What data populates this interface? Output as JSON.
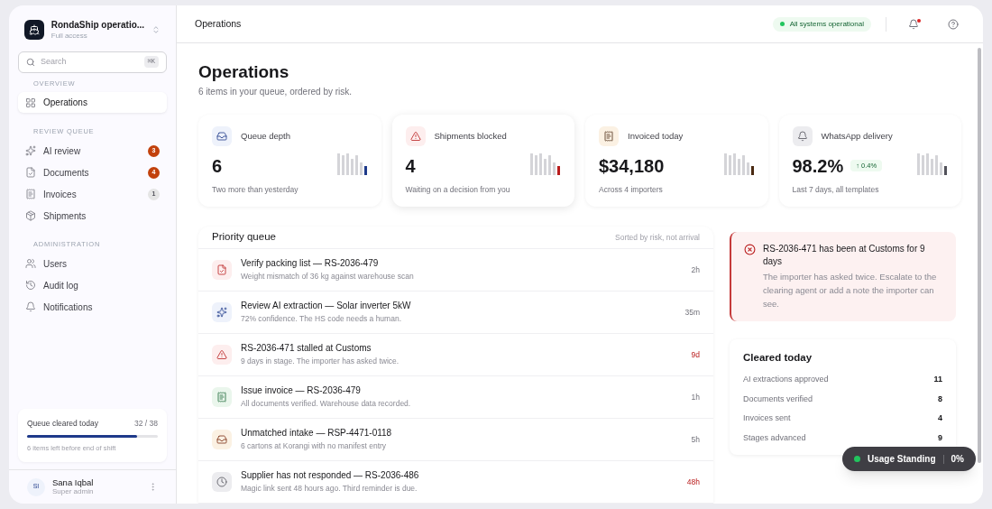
{
  "workspace": {
    "name": "RondaShip operatio...",
    "subtitle": "Full access"
  },
  "search": {
    "placeholder": "Search",
    "shortcut": "⌘K"
  },
  "sidebar": {
    "sections": [
      {
        "title": "OVERVIEW",
        "items": [
          {
            "label": "Operations",
            "kind": "grid",
            "selected": true
          }
        ]
      },
      {
        "title": "REVIEW QUEUE",
        "items": [
          {
            "label": "AI review",
            "kind": "sparkle",
            "selected": false,
            "badge": "3",
            "color": "#c2410c"
          },
          {
            "label": "Documents",
            "kind": "document",
            "selected": false,
            "badge": "4",
            "color": "#c2410c"
          },
          {
            "label": "Invoices",
            "kind": "invoice",
            "selected": false,
            "badge": "1",
            "color": "#e5e5e5"
          },
          {
            "label": "Shipments",
            "kind": "box",
            "selected": false
          }
        ]
      },
      {
        "title": "ADMINISTRATION",
        "items": [
          {
            "label": "Users",
            "kind": "users",
            "selected": false
          },
          {
            "label": "Audit log",
            "kind": "history",
            "selected": false
          },
          {
            "label": "Notifications",
            "kind": "bell",
            "selected": false
          }
        ]
      }
    ]
  },
  "progress": {
    "title": "Queue cleared today",
    "count": "32 / 38",
    "level": 0.84,
    "note": "6 items left before end of shift"
  },
  "user": {
    "initials": "SI",
    "name": "Sana Iqbal",
    "role": "Super admin"
  },
  "topbar": {
    "title": "Operations",
    "status": "All systems operational"
  },
  "page": {
    "title": "Operations",
    "subtitle": "6 items in your queue, ordered by risk."
  },
  "stats": [
    {
      "kind": "inbox",
      "label": "Queue depth",
      "value": "6",
      "note": "Two more than yesterday",
      "color": "#1e3a8a"
    },
    {
      "kind": "warning",
      "label": "Shipments blocked",
      "value": "4",
      "note": "Waiting on a decision from you",
      "color": "#b91c1c"
    },
    {
      "kind": "invoice",
      "label": "Invoiced today",
      "value": "$34,180",
      "note": "Across 4 importers",
      "color": "#4a2a12"
    },
    {
      "kind": "bell",
      "label": "WhatsApp delivery",
      "value": "98.2%",
      "delta": "↑ 0.4%",
      "note": "Last 7 days, all templates",
      "color": "#52525b"
    }
  ],
  "queue": {
    "title": "Priority queue",
    "hint": "Sorted by risk, not arrival",
    "rows": [
      {
        "kind": "document",
        "title": "Verify packing list — RS-2036-479",
        "detail": "Weight mismatch of 36 kg against warehouse scan",
        "age": "2h",
        "urgent": false
      },
      {
        "kind": "sparkle",
        "title": "Review AI extraction — Solar inverter 5kW",
        "detail": "72% confidence. The HS code needs a human.",
        "age": "35m",
        "urgent": false
      },
      {
        "kind": "warning",
        "title": "RS-2036-471 stalled at Customs",
        "detail": "9 days in stage. The importer has asked twice.",
        "age": "9d",
        "urgent": true
      },
      {
        "kind": "invoice",
        "title": "Issue invoice — RS-2036-479",
        "detail": "All documents verified. Warehouse data recorded.",
        "age": "1h",
        "urgent": false
      },
      {
        "kind": "inbox",
        "title": "Unmatched intake — RSP-4471-0118",
        "detail": "6 cartons at Korangi with no manifest entry",
        "age": "5h",
        "urgent": false
      },
      {
        "kind": "clock",
        "title": "Supplier has not responded — RS-2036-486",
        "detail": "Magic link sent 48 hours ago. Third reminder is due.",
        "age": "48h",
        "urgent": true
      }
    ]
  },
  "alert": {
    "title": "RS-2036-471 has been at Customs for 9 days",
    "body": "The importer has asked twice. Escalate to the clearing agent or add a note the importer can see."
  },
  "cleared": {
    "title": "Cleared today",
    "rows": [
      {
        "label": "AI extractions approved",
        "value": "11"
      },
      {
        "label": "Documents verified",
        "value": "8"
      },
      {
        "label": "Invoices sent",
        "value": "4"
      },
      {
        "label": "Stages advanced",
        "value": "9"
      }
    ]
  },
  "usage": {
    "label": "Usage Standing",
    "value": "0%"
  }
}
